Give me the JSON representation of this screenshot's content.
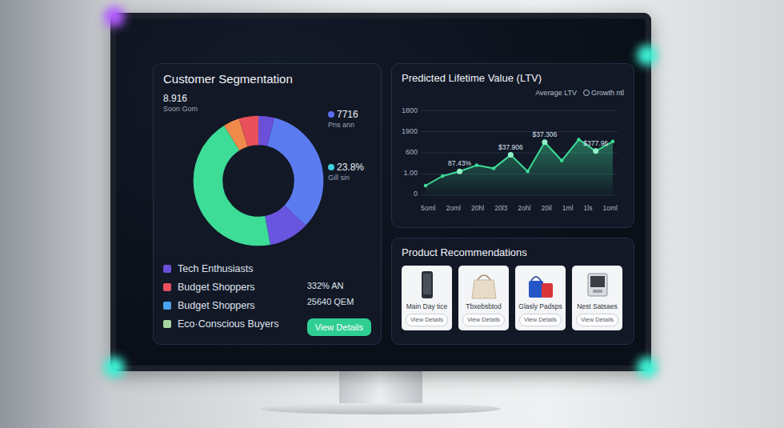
{
  "segmentation": {
    "title": "Customer Segmentation",
    "segments": [
      {
        "value": 4,
        "color": "#6b4fd8"
      },
      {
        "value": 33,
        "color": "#5b7bf0"
      },
      {
        "value": 10,
        "color": "#6a55e0"
      },
      {
        "value": 44,
        "color": "#3ddc97"
      },
      {
        "value": 4,
        "color": "#f08a4b"
      },
      {
        "value": 5,
        "color": "#e8505b"
      }
    ],
    "callouts": [
      {
        "value": "8.916",
        "label": "Soon Gom"
      },
      {
        "value": "7716",
        "label": "Pns ann",
        "color": "#5b6cf0"
      },
      {
        "value": "23.8%",
        "label": "Gill sin",
        "color": "#3fd0e0"
      }
    ],
    "legend": [
      {
        "label": "Tech Enthusiasts",
        "color": "#6b4fd8"
      },
      {
        "label": "Budget Shoppers",
        "color": "#e8505b"
      },
      {
        "label": "Budget Shoppers",
        "color": "#4aa3f0"
      },
      {
        "label": "Eco·Conscious Buyers",
        "color": "#a8d5a0"
      }
    ],
    "stats": [
      "332% AN",
      "25640 QEM"
    ],
    "button": "View Details"
  },
  "ltv": {
    "title": "Predicted Lifetime Value (LTV)",
    "legend": [
      "Average LTV",
      "Growth ntl"
    ],
    "y_ticks": [
      "1800",
      "1900",
      "600",
      "1.00",
      "0"
    ],
    "y_max": 2000,
    "x_ticks": [
      "5oml",
      "2oml",
      "20hl",
      "20l3",
      "2ohl",
      "20il",
      "1ml",
      "1ls",
      "1oml"
    ],
    "values": [
      250,
      500,
      620,
      780,
      700,
      1050,
      620,
      1380,
      900,
      1450,
      1150,
      1400
    ],
    "annotations": [
      {
        "text": "87.43%",
        "index": 2
      },
      {
        "text": "$37.906",
        "index": 5
      },
      {
        "text": "$37.306",
        "index": 7
      },
      {
        "text": "$377.96",
        "index": 10
      }
    ]
  },
  "products": {
    "title": "Product Recommendations",
    "items": [
      {
        "name": "Main Day tice",
        "button": "View Details",
        "kind": "phone"
      },
      {
        "name": "Tbxebsbtod",
        "button": "View Details",
        "kind": "tote"
      },
      {
        "name": "Glasly Padsps",
        "button": "View Details",
        "kind": "bag"
      },
      {
        "name": "Nest Satsaes",
        "button": "View Details",
        "kind": "gadget"
      }
    ]
  }
}
